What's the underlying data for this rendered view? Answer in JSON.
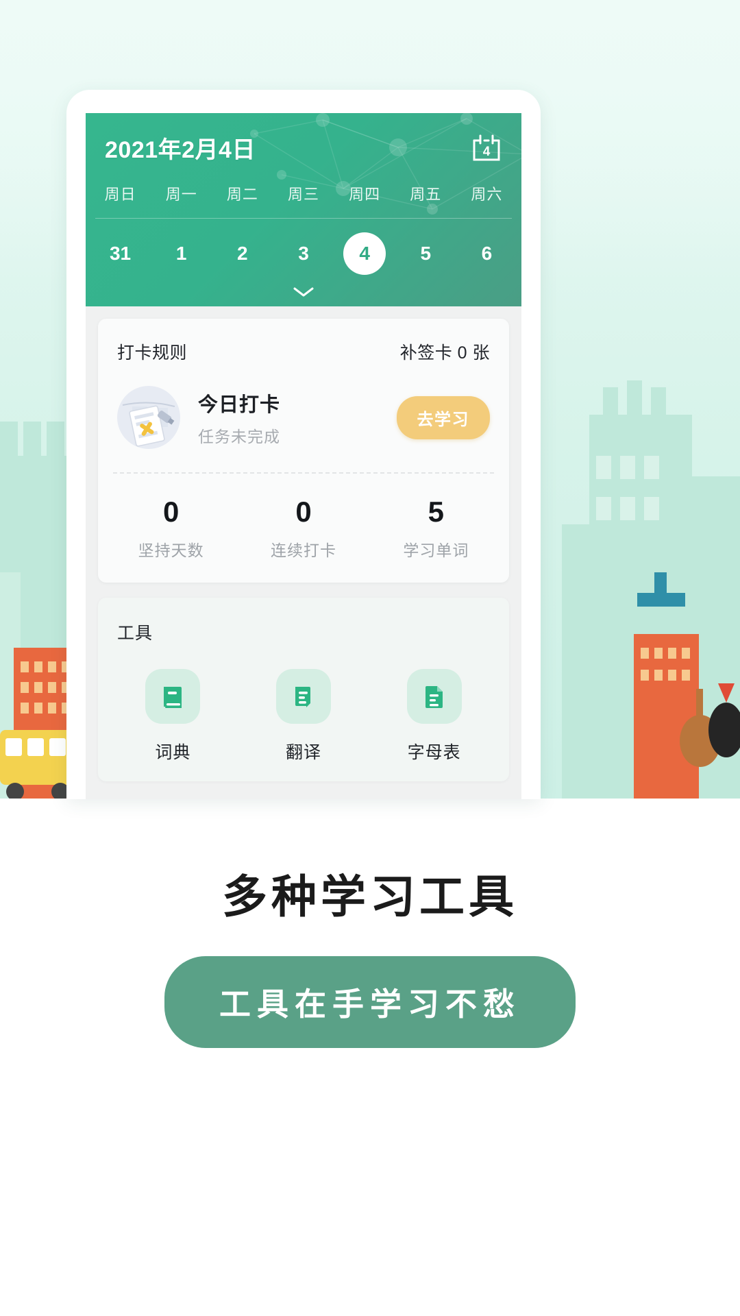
{
  "header": {
    "date_title": "2021年2月4日",
    "calendar_icon_day": "4",
    "weekdays": [
      "周日",
      "周一",
      "周二",
      "周三",
      "周四",
      "周五",
      "周六"
    ],
    "days": [
      "31",
      "1",
      "2",
      "3",
      "4",
      "5",
      "6"
    ],
    "selected_day": "4",
    "expand_icon": "chevron-down-icon"
  },
  "checkin_card": {
    "rule_label": "打卡规则",
    "makeup_card_label": "补签卡 0 张",
    "today_title": "今日打卡",
    "today_status": "任务未完成",
    "action_button": "去学习",
    "stats": [
      {
        "value": "0",
        "label": "坚持天数"
      },
      {
        "value": "0",
        "label": "连续打卡"
      },
      {
        "value": "5",
        "label": "学习单词"
      }
    ]
  },
  "tools": {
    "title": "工具",
    "items": [
      {
        "label": "词典",
        "icon": "book-icon"
      },
      {
        "label": "翻译",
        "icon": "document-lines-icon"
      },
      {
        "label": "字母表",
        "icon": "file-text-icon"
      }
    ]
  },
  "promo": {
    "tagline": "多种学习工具",
    "pill_text": "工具在手学习不愁"
  },
  "colors": {
    "header_green": "#35b28d",
    "accent_yellow": "#f3cc7b",
    "pill_green": "#5aa187",
    "tool_icon_green": "#2cb583",
    "page_bg": "#d7f3ea"
  }
}
